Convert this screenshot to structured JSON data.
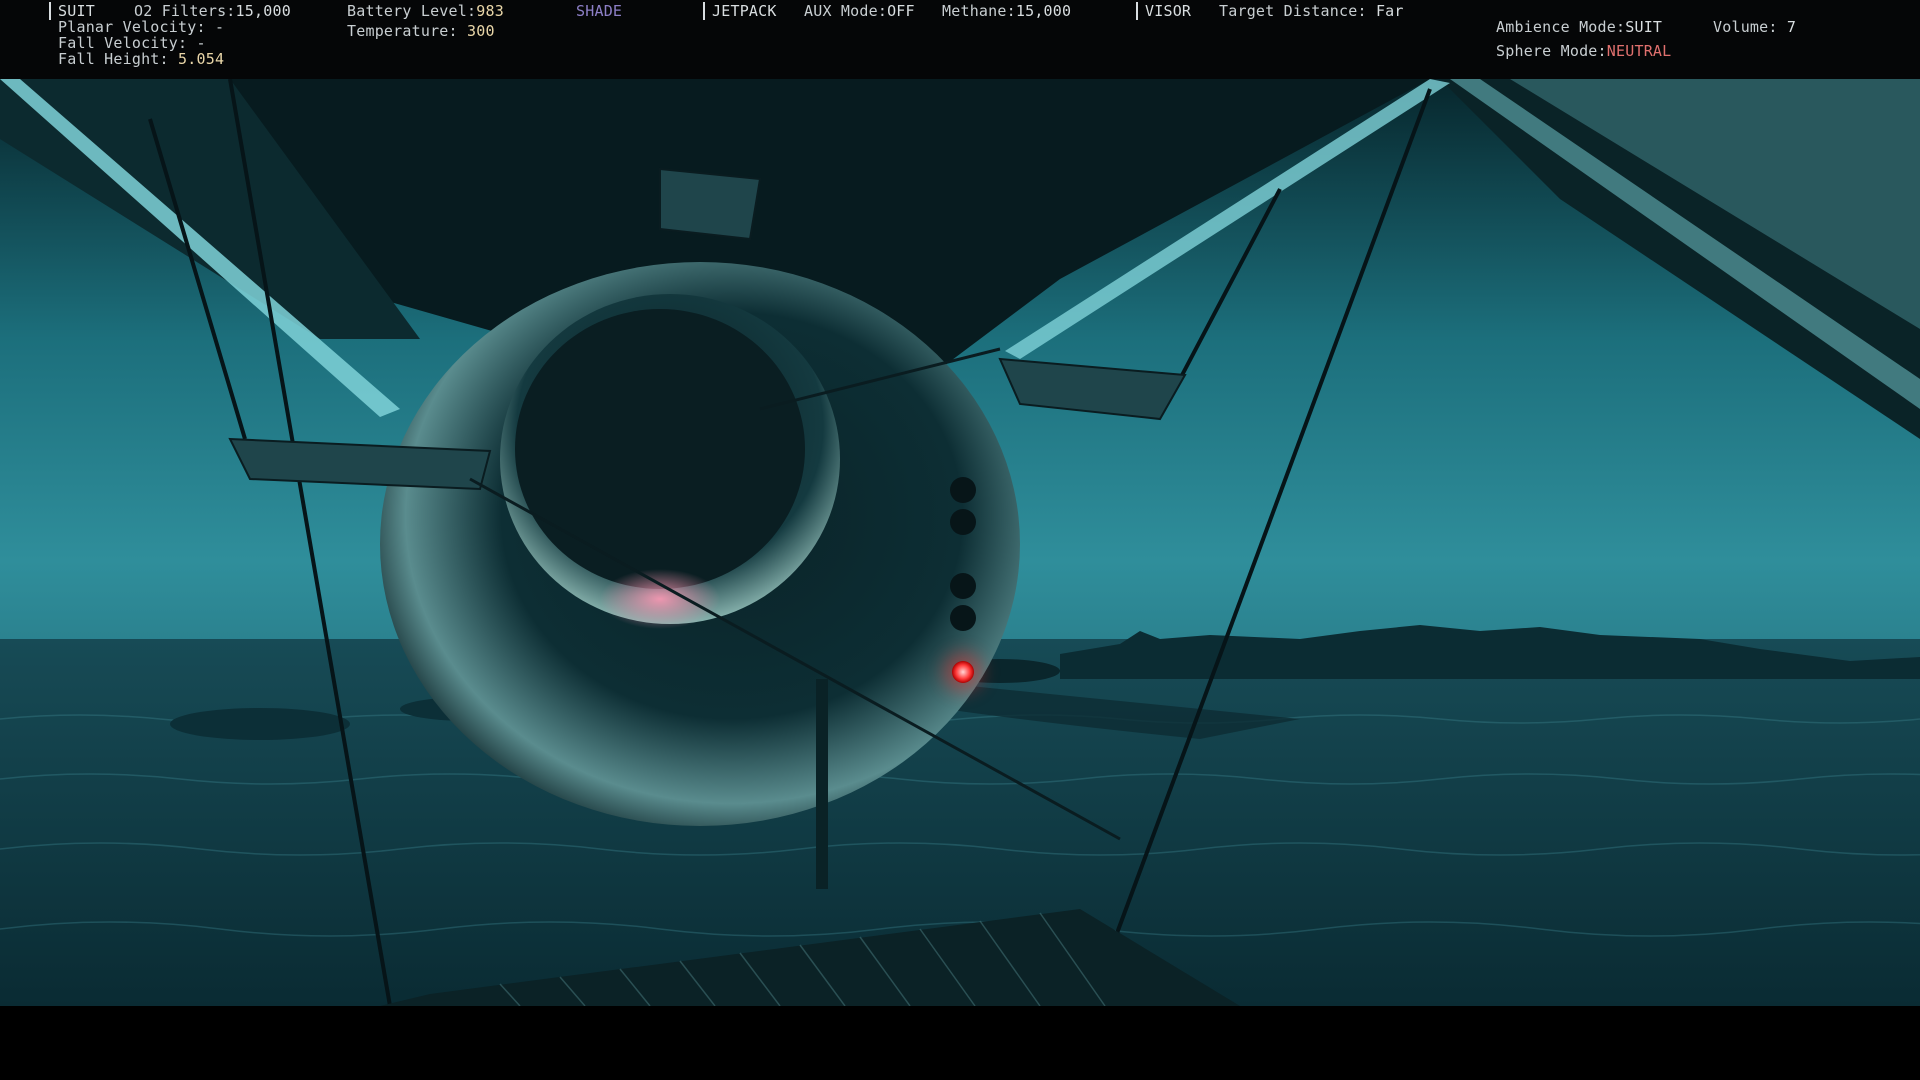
{
  "hud": {
    "suit": {
      "title": "SUIT",
      "o2_label": "O2 Filters:",
      "o2_value": "15,000",
      "planar_velocity_label": "Planar Velocity:",
      "planar_velocity_value": "-",
      "fall_velocity_label": "Fall Velocity:",
      "fall_velocity_value": "-",
      "fall_height_label": "Fall Height:",
      "fall_height_value": "5.054",
      "battery_label": "Battery Level:",
      "battery_value": "983",
      "temperature_label": "Temperature:",
      "temperature_value": "300",
      "shade_label": "SHADE"
    },
    "jetpack": {
      "title": "JETPACK",
      "aux_label": "AUX Mode:",
      "aux_value": "OFF",
      "methane_label": "Methane:",
      "methane_value": "15,000"
    },
    "visor": {
      "title": "VISOR",
      "target_label": "Target Distance:",
      "target_value": "Far"
    },
    "ambience": {
      "ambience_label": "Ambience Mode:",
      "ambience_value": "SUIT",
      "volume_label": "Volume:",
      "volume_value": "7",
      "sphere_label": "Sphere Mode:",
      "sphere_value": "NEUTRAL"
    }
  },
  "colors": {
    "hud_background": "#050607",
    "value_yellow": "#e9d6a8",
    "shade_purple": "#8d7fc6",
    "sphere_red": "#e0706e",
    "sky_teal": "#2f8e9b",
    "beacon_red": "#ff3a3a"
  }
}
